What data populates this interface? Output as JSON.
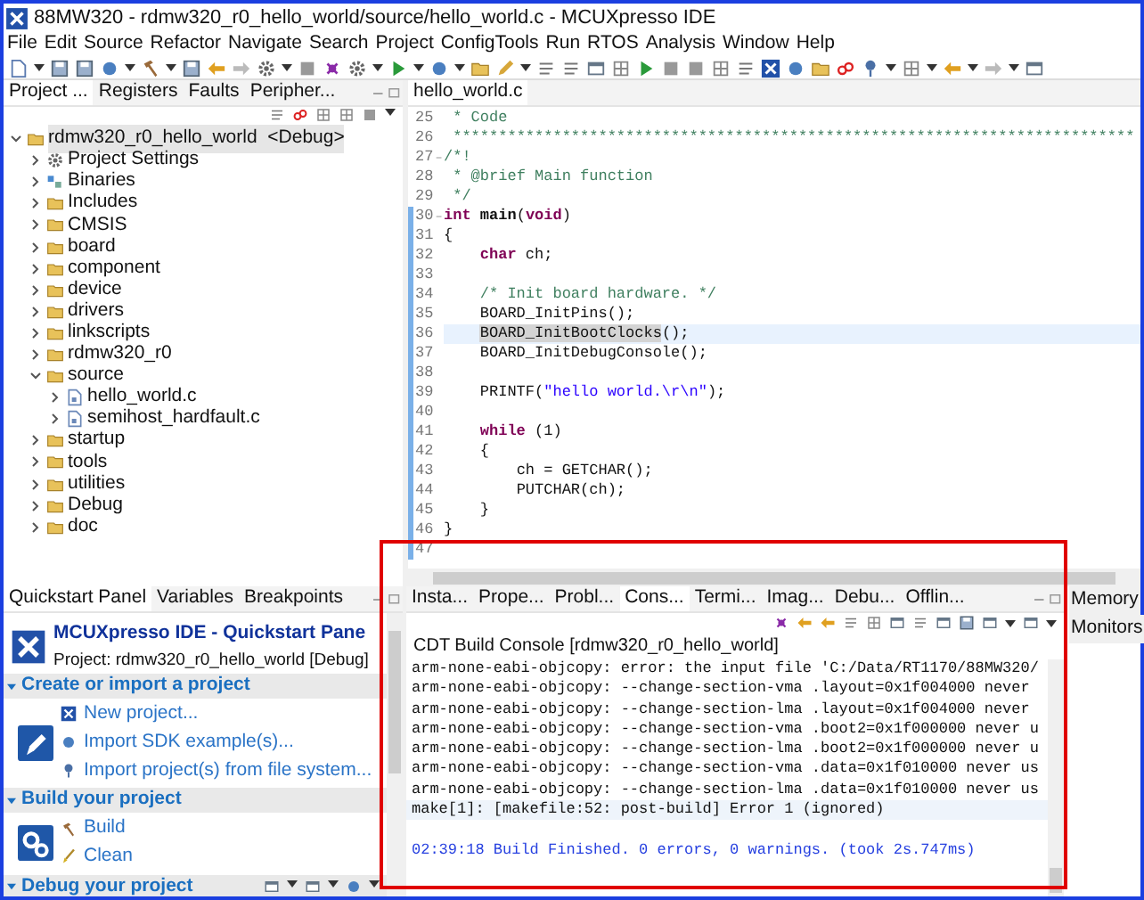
{
  "window": {
    "title": "88MW320 - rdmw320_r0_hello_world/source/hello_world.c - MCUXpresso IDE"
  },
  "menu": [
    "File",
    "Edit",
    "Source",
    "Refactor",
    "Navigate",
    "Search",
    "Project",
    "ConfigTools",
    "Run",
    "RTOS",
    "Analysis",
    "Window",
    "Help"
  ],
  "left_tabs": [
    {
      "label": "Project ...",
      "selected": true
    },
    {
      "label": "Registers",
      "selected": false
    },
    {
      "label": "Faults",
      "selected": false
    },
    {
      "label": "Peripher...",
      "selected": false
    }
  ],
  "project_tree": [
    {
      "label": "rdmw320_r0_hello_world",
      "config": "<Debug>",
      "kind": "project",
      "expanded": true,
      "selected": true,
      "children": [
        {
          "label": "Project Settings",
          "kind": "settings",
          "expanded": false,
          "selected": false
        },
        {
          "label": "Binaries",
          "kind": "binaries",
          "expanded": false,
          "selected": false
        },
        {
          "label": "Includes",
          "kind": "includes",
          "expanded": false,
          "selected": false
        },
        {
          "label": "CMSIS",
          "kind": "source_folder",
          "expanded": false,
          "selected": false
        },
        {
          "label": "board",
          "kind": "source_folder",
          "expanded": false,
          "selected": false
        },
        {
          "label": "component",
          "kind": "source_folder",
          "expanded": false,
          "selected": false
        },
        {
          "label": "device",
          "kind": "source_folder",
          "expanded": false,
          "selected": false
        },
        {
          "label": "drivers",
          "kind": "source_folder",
          "expanded": false,
          "selected": false
        },
        {
          "label": "linkscripts",
          "kind": "source_folder",
          "expanded": false,
          "selected": false
        },
        {
          "label": "rdmw320_r0",
          "kind": "source_folder",
          "expanded": false,
          "selected": false
        },
        {
          "label": "source",
          "kind": "source_folder",
          "expanded": true,
          "selected": false,
          "children": [
            {
              "label": "hello_world.c",
              "kind": "file",
              "expanded": false,
              "selected": false
            },
            {
              "label": "semihost_hardfault.c",
              "kind": "file",
              "expanded": false,
              "selected": false
            }
          ]
        },
        {
          "label": "startup",
          "kind": "source_folder",
          "expanded": false,
          "selected": false
        },
        {
          "label": "tools",
          "kind": "source_folder",
          "expanded": false,
          "selected": false
        },
        {
          "label": "utilities",
          "kind": "source_folder",
          "expanded": false,
          "selected": false
        },
        {
          "label": "Debug",
          "kind": "folder",
          "expanded": false,
          "selected": false
        },
        {
          "label": "doc",
          "kind": "folder",
          "expanded": false,
          "selected": false
        }
      ]
    }
  ],
  "editor": {
    "tabs": [
      {
        "label": "hello_world.c",
        "selected": true
      }
    ],
    "lines": [
      {
        "number": "25",
        "foldable": false,
        "marked": false,
        "selected": false,
        "segments": [
          {
            "kind": "comment",
            "text": " * Code"
          }
        ]
      },
      {
        "number": "26",
        "foldable": false,
        "marked": false,
        "selected": false,
        "segments": [
          {
            "kind": "comment",
            "text": " ***************************************************************************"
          }
        ]
      },
      {
        "number": "27",
        "foldable": true,
        "marked": false,
        "selected": false,
        "segments": [
          {
            "kind": "comment",
            "text": "/*!"
          }
        ]
      },
      {
        "number": "28",
        "foldable": false,
        "marked": false,
        "selected": false,
        "segments": [
          {
            "kind": "comment",
            "text": " * @brief Main function"
          }
        ]
      },
      {
        "number": "29",
        "foldable": false,
        "marked": false,
        "selected": false,
        "segments": [
          {
            "kind": "comment",
            "text": " */"
          }
        ]
      },
      {
        "number": "30",
        "foldable": true,
        "marked": true,
        "selected": false,
        "segments": [
          {
            "kind": "keyword",
            "text": "int"
          },
          {
            "kind": "bold",
            "text": " main"
          },
          {
            "kind": "plain",
            "text": "("
          },
          {
            "kind": "keyword",
            "text": "void"
          },
          {
            "kind": "plain",
            "text": ")"
          }
        ]
      },
      {
        "number": "31",
        "foldable": false,
        "marked": true,
        "selected": false,
        "segments": [
          {
            "kind": "plain",
            "text": "{"
          }
        ]
      },
      {
        "number": "32",
        "foldable": false,
        "marked": true,
        "selected": false,
        "segments": [
          {
            "kind": "keyword",
            "text": "    char"
          },
          {
            "kind": "plain",
            "text": " ch;"
          }
        ]
      },
      {
        "number": "33",
        "foldable": false,
        "marked": true,
        "selected": false
      },
      {
        "number": "34",
        "foldable": false,
        "marked": true,
        "selected": false,
        "segments": [
          {
            "kind": "comment",
            "text": "    /* Init board hardware. */"
          }
        ]
      },
      {
        "number": "35",
        "foldable": false,
        "marked": true,
        "selected": false,
        "segments": [
          {
            "kind": "plain",
            "text": "    BOARD_InitPins();"
          }
        ]
      },
      {
        "number": "36",
        "foldable": false,
        "marked": true,
        "selected": true,
        "segments": [
          {
            "kind": "occurrence",
            "text": "    BOARD_InitBootClocks"
          },
          {
            "kind": "plain",
            "text": "();"
          }
        ]
      },
      {
        "number": "37",
        "foldable": false,
        "marked": true,
        "selected": false,
        "segments": [
          {
            "kind": "plain",
            "text": "    BOARD_InitDebugConsole();"
          }
        ]
      },
      {
        "number": "38",
        "foldable": false,
        "marked": true,
        "selected": false
      },
      {
        "number": "39",
        "foldable": false,
        "marked": true,
        "selected": false,
        "segments": [
          {
            "kind": "plain",
            "text": "    PRINTF("
          },
          {
            "kind": "string",
            "text": "\"hello world.\\r\\n\""
          },
          {
            "kind": "plain",
            "text": ");"
          }
        ]
      },
      {
        "number": "40",
        "foldable": false,
        "marked": true,
        "selected": false
      },
      {
        "number": "41",
        "foldable": false,
        "marked": true,
        "selected": false,
        "segments": [
          {
            "kind": "keyword",
            "text": "    while"
          },
          {
            "kind": "plain",
            "text": " (1)"
          }
        ]
      },
      {
        "number": "42",
        "foldable": false,
        "marked": true,
        "selected": false,
        "segments": [
          {
            "kind": "plain",
            "text": "    {"
          }
        ]
      },
      {
        "number": "43",
        "foldable": false,
        "marked": true,
        "selected": false,
        "segments": [
          {
            "kind": "plain",
            "text": "        ch = GETCHAR();"
          }
        ]
      },
      {
        "number": "44",
        "foldable": false,
        "marked": true,
        "selected": false,
        "segments": [
          {
            "kind": "plain",
            "text": "        PUTCHAR(ch);"
          }
        ]
      },
      {
        "number": "45",
        "foldable": false,
        "marked": true,
        "selected": false,
        "segments": [
          {
            "kind": "plain",
            "text": "    }"
          }
        ]
      },
      {
        "number": "46",
        "foldable": false,
        "marked": true,
        "selected": false,
        "segments": [
          {
            "kind": "plain",
            "text": "}"
          }
        ]
      },
      {
        "number": "47",
        "foldable": false,
        "marked": true,
        "selected": false
      }
    ]
  },
  "quickstart": {
    "tabs": [
      {
        "label": "Quickstart Panel",
        "selected": true
      },
      {
        "label": "Variables",
        "selected": false
      },
      {
        "label": "Breakpoints",
        "selected": false
      }
    ],
    "title": "MCUXpresso IDE - Quickstart Pane",
    "project": "Project: rdmw320_r0_hello_world [Debug]",
    "sections": [
      {
        "title": "Create or import a project",
        "kind": "create",
        "expanded": true,
        "links": [
          {
            "label": "New project...",
            "kind": "new"
          },
          {
            "label": "Import SDK example(s)...",
            "kind": "sdk"
          },
          {
            "label": "Import project(s) from file system...",
            "kind": "import"
          }
        ]
      },
      {
        "title": "Build your project",
        "kind": "build",
        "expanded": true,
        "links": [
          {
            "label": "Build",
            "kind": "build"
          },
          {
            "label": "Clean",
            "kind": "clean"
          }
        ]
      },
      {
        "title": "Debug your project",
        "kind": "debug",
        "expanded": true
      }
    ]
  },
  "console": {
    "tabs": [
      {
        "label": "Insta...",
        "selected": false
      },
      {
        "label": "Prope...",
        "selected": false
      },
      {
        "label": "Probl...",
        "selected": false
      },
      {
        "label": "Cons...",
        "selected": true
      },
      {
        "label": "Termi...",
        "selected": false
      },
      {
        "label": "Imag...",
        "selected": false
      },
      {
        "label": "Debu...",
        "selected": false
      },
      {
        "label": "Offlin...",
        "selected": false
      }
    ],
    "title": "CDT Build Console [rdmw320_r0_hello_world]",
    "lines": [
      {
        "kind": "output",
        "selected": false,
        "text": "arm-none-eabi-objcopy: error: the input file 'C:/Data/RT1170/88MW320/"
      },
      {
        "kind": "output",
        "selected": false,
        "text": "arm-none-eabi-objcopy: --change-section-vma .layout=0x1f004000 never"
      },
      {
        "kind": "output",
        "selected": false,
        "text": "arm-none-eabi-objcopy: --change-section-lma .layout=0x1f004000 never"
      },
      {
        "kind": "output",
        "selected": false,
        "text": "arm-none-eabi-objcopy: --change-section-vma .boot2=0x1f000000 never u"
      },
      {
        "kind": "output",
        "selected": false,
        "text": "arm-none-eabi-objcopy: --change-section-lma .boot2=0x1f000000 never u"
      },
      {
        "kind": "output",
        "selected": false,
        "text": "arm-none-eabi-objcopy: --change-section-vma .data=0x1f010000 never us"
      },
      {
        "kind": "output",
        "selected": false,
        "text": "arm-none-eabi-objcopy: --change-section-lma .data=0x1f010000 never us"
      },
      {
        "kind": "output",
        "selected": true,
        "text": "make[1]: [makefile:52: post-build] Error 1 (ignored)"
      },
      {
        "kind": "blank",
        "selected": false
      },
      {
        "kind": "status",
        "selected": false,
        "text": "02:39:18 Build Finished. 0 errors, 0 warnings. (took 2s.747ms)"
      }
    ]
  },
  "memory_panel": {
    "tabs": [
      {
        "label": "Memory",
        "selected": false
      },
      {
        "label": "Monitors",
        "selected": false
      }
    ]
  }
}
